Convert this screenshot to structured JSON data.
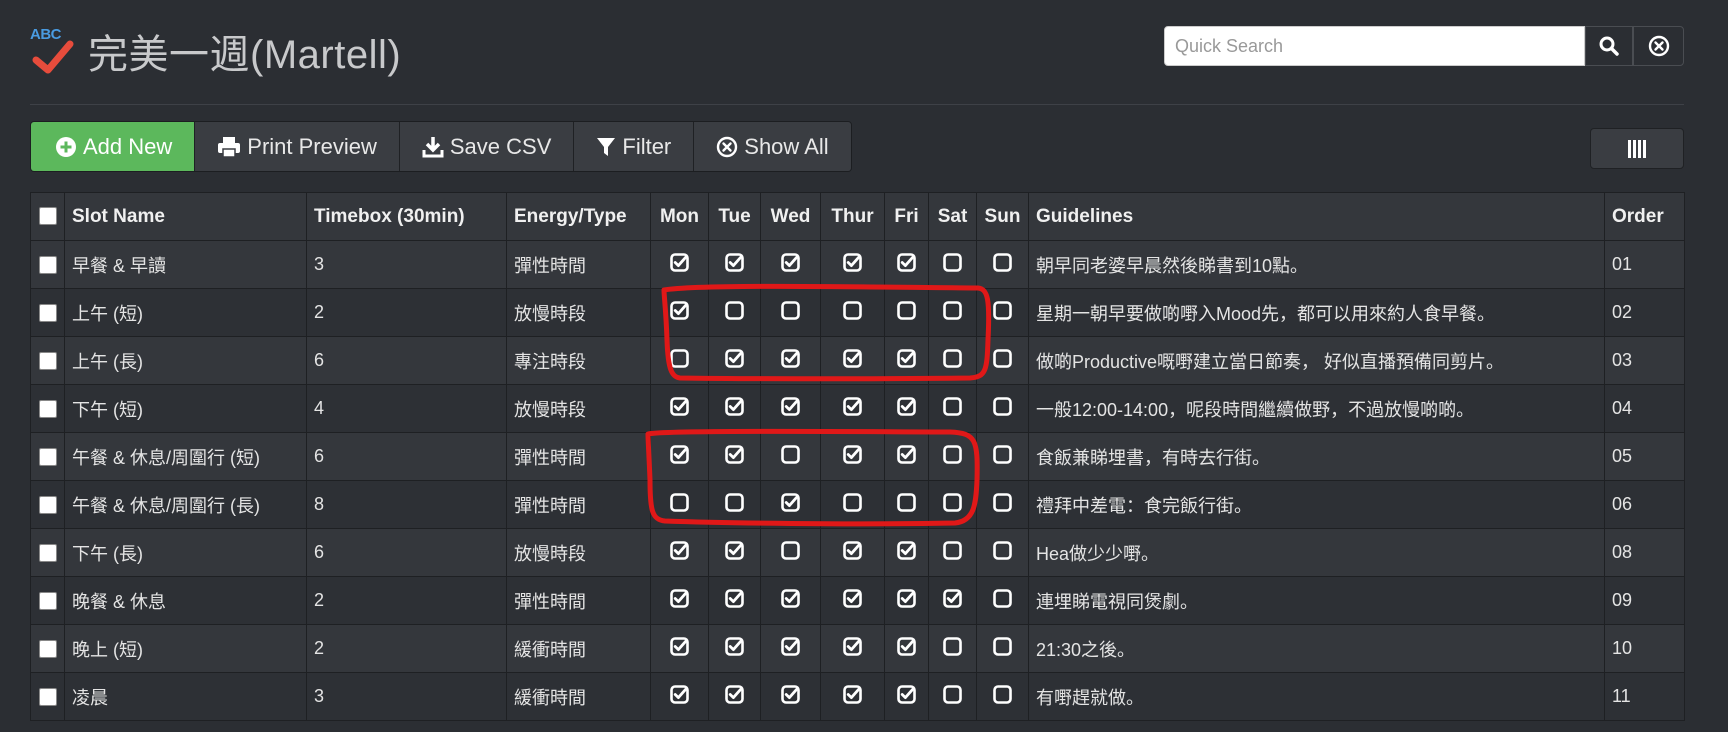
{
  "app": {
    "title": "完美一週(Martell)",
    "logo_text": "ABC"
  },
  "search": {
    "placeholder": "Quick Search"
  },
  "toolbar": {
    "add_new": "Add New",
    "print_preview": "Print Preview",
    "save_csv": "Save CSV",
    "filter": "Filter",
    "show_all": "Show All"
  },
  "colors": {
    "add_new": "#5cb85c",
    "annotation": "#e01818",
    "background": "#2b2e33"
  },
  "table": {
    "columns": {
      "slot_name": "Slot Name",
      "timebox": "Timebox (30min)",
      "energy": "Energy/Type",
      "mon": "Mon",
      "tue": "Tue",
      "wed": "Wed",
      "thur": "Thur",
      "fri": "Fri",
      "sat": "Sat",
      "sun": "Sun",
      "guidelines": "Guidelines",
      "order": "Order"
    },
    "rows": [
      {
        "slot": "早餐 & 早讀",
        "timebox": "3",
        "energy": "彈性時間",
        "days": [
          true,
          true,
          true,
          true,
          true,
          false,
          false
        ],
        "guidelines": "朝早同老婆早晨然後睇書到10點。",
        "order": "01"
      },
      {
        "slot": "上午 (短)",
        "timebox": "2",
        "energy": "放慢時段",
        "days": [
          true,
          false,
          false,
          false,
          false,
          false,
          false
        ],
        "guidelines": "星期一朝早要做啲嘢入Mood先，都可以用來約人食早餐。",
        "order": "02"
      },
      {
        "slot": "上午 (長)",
        "timebox": "6",
        "energy": "專注時段",
        "days": [
          false,
          true,
          true,
          true,
          true,
          false,
          false
        ],
        "guidelines": "做啲Productive嘅嘢建立當日節奏， 好似直播預備同剪片。",
        "order": "03"
      },
      {
        "slot": "下午 (短)",
        "timebox": "4",
        "energy": "放慢時段",
        "days": [
          true,
          true,
          true,
          true,
          true,
          false,
          false
        ],
        "guidelines": "一般12:00-14:00，呢段時間繼續做野，不過放慢啲啲。",
        "order": "04"
      },
      {
        "slot": "午餐 & 休息/周圍行 (短)",
        "timebox": "6",
        "energy": "彈性時間",
        "days": [
          true,
          true,
          false,
          true,
          true,
          false,
          false
        ],
        "guidelines": "食飯兼睇埋書，有時去行街。",
        "order": "05"
      },
      {
        "slot": "午餐 & 休息/周圍行 (長)",
        "timebox": "8",
        "energy": "彈性時間",
        "days": [
          false,
          false,
          true,
          false,
          false,
          false,
          false
        ],
        "guidelines": "禮拜中差電：食完飯行街。",
        "order": "06"
      },
      {
        "slot": "下午 (長)",
        "timebox": "6",
        "energy": "放慢時段",
        "days": [
          true,
          true,
          false,
          true,
          true,
          false,
          false
        ],
        "guidelines": "Hea做少少嘢。",
        "order": "08"
      },
      {
        "slot": "晚餐 & 休息",
        "timebox": "2",
        "energy": "彈性時間",
        "days": [
          true,
          true,
          true,
          true,
          true,
          true,
          false
        ],
        "guidelines": "連埋睇電視同煲劇。",
        "order": "09"
      },
      {
        "slot": "晚上 (短)",
        "timebox": "2",
        "energy": "緩衝時間",
        "days": [
          true,
          true,
          true,
          true,
          true,
          false,
          false
        ],
        "guidelines": "21:30之後。",
        "order": "10"
      },
      {
        "slot": "凌晨",
        "timebox": "3",
        "energy": "緩衝時間",
        "days": [
          true,
          true,
          true,
          true,
          true,
          false,
          false
        ],
        "guidelines": "有嘢趕就做。",
        "order": "11"
      }
    ]
  }
}
